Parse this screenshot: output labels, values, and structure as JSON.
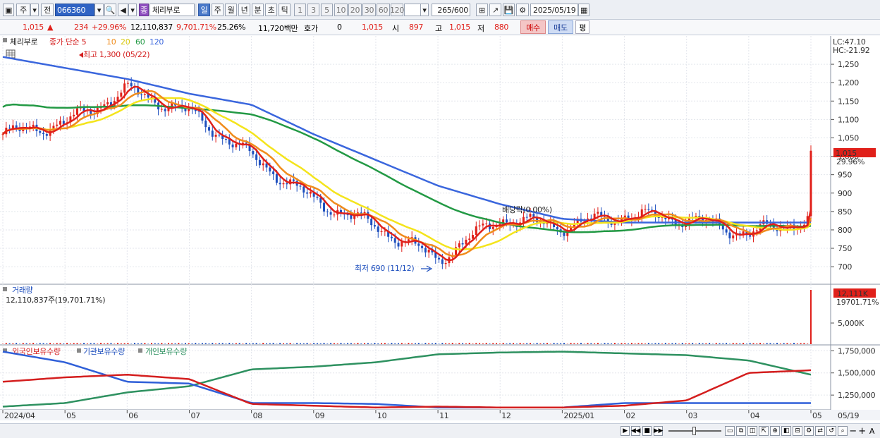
{
  "toolbar": {
    "market": "주",
    "prev_label": "전",
    "stock_code": "066360",
    "stock_name_badge": "종",
    "stock_name": "체리부로",
    "periods": [
      "일",
      "주",
      "월",
      "년",
      "분",
      "초",
      "틱"
    ],
    "selected_period": "일",
    "intervals": [
      "1",
      "3",
      "5",
      "10",
      "20",
      "30",
      "60",
      "120"
    ],
    "count": "265",
    "count_total": "/600",
    "date": "2025/05/19"
  },
  "info": {
    "price": "1,015",
    "change": "234",
    "change_pct": "+29.96%",
    "volume": "12,110,837",
    "volume_pct": "9,701.71%",
    "turnover": "25.26%",
    "amount": "11,720백만",
    "hoga_label": "호가",
    "hoga_value": "0",
    "hoga_price": "1,015",
    "open_label": "시",
    "open_value": "897",
    "high_label": "고",
    "high_value": "1,015",
    "low_label": "저",
    "low_value": "880",
    "buy_label": "매수",
    "sell_label": "매도",
    "avg_label": "평"
  },
  "price_pane": {
    "legend_name": "체리부로",
    "legend_ma": "종가 단순 5",
    "ma_periods": [
      "10",
      "20",
      "60",
      "120"
    ],
    "ma_colors": {
      "ma5": "#e0201a",
      "ma10": "#f08c1c",
      "ma20": "#f4e41c",
      "ma60": "#229944",
      "ma120": "#3a66dd"
    },
    "high_note": "최고 1,300 (05/22)",
    "low_note": "최저 690 (11/12)",
    "dividend_note": "배당락(0.00%)",
    "lc_label": "LC:47.10",
    "hc_label": "HC:-21.92",
    "current_label": "1,015",
    "current_pct": "29.96%"
  },
  "volume_pane": {
    "title": "거래량",
    "value_text": "12,110,837주(19,701.71%)",
    "current_label": "12,111K",
    "current_pct": "19701.71%",
    "axis_label": "5,000K"
  },
  "holdings_pane": {
    "foreign_label": "외국인보유수량",
    "inst_label": "기관보유수량",
    "indiv_label": "개인보유수량",
    "axis": [
      "1,750,000",
      "1,500,000",
      "1,250,000"
    ],
    "colors": {
      "foreign": "#d41e1e",
      "inst": "#2f5fd8",
      "indiv": "#2e9160"
    }
  },
  "x_axis": {
    "labels": [
      "2024/04",
      "05",
      "06",
      "07",
      "08",
      "09",
      "10",
      "11",
      "12",
      "2025/01",
      "02",
      "03",
      "04",
      "05"
    ],
    "end_label": "05/19"
  },
  "chart_data": [
    {
      "type": "line",
      "title": "체리부로",
      "x": [
        "2024/04",
        "2024/05",
        "2024/06",
        "2024/07",
        "2024/08",
        "2024/09",
        "2024/10",
        "2024/11",
        "2024/12",
        "2025/01",
        "2025/02",
        "2025/03",
        "2025/04",
        "2025/05"
      ],
      "ylim": [
        660,
        1300
      ],
      "y_ticks": [
        700,
        750,
        800,
        850,
        900,
        950,
        1000,
        1050,
        1100,
        1150,
        1200,
        1250
      ],
      "series": [
        {
          "name": "5",
          "values": [
            1060,
            1090,
            1180,
            1120,
            1000,
            880,
            810,
            720,
            830,
            810,
            840,
            830,
            790,
            830
          ]
        },
        {
          "name": "120",
          "values": [
            1270,
            1240,
            1210,
            1170,
            1140,
            1060,
            990,
            920,
            870,
            830,
            820,
            820,
            820,
            820
          ]
        }
      ],
      "annotations": [
        {
          "text": "최고 1,300 (05/22)",
          "value": 1300
        },
        {
          "text": "최저 690 (11/12)",
          "value": 690
        },
        {
          "text": "배당락(0.00%)"
        }
      ],
      "last_price": 1015
    },
    {
      "type": "bar",
      "title": "거래량",
      "y_ticks": [
        5000000
      ],
      "last_value": 12110837
    },
    {
      "type": "line",
      "x": [
        "2024/04",
        "2024/05",
        "2024/06",
        "2024/07",
        "2024/08",
        "2024/09",
        "2024/10",
        "2024/11",
        "2024/12",
        "2025/01",
        "2025/02",
        "2025/03",
        "2025/04",
        "2025/05"
      ],
      "y_ticks": [
        1250000,
        1500000,
        1750000
      ],
      "ylim": [
        1100000,
        1800000
      ],
      "series": [
        {
          "name": "외국인보유수량",
          "values": [
            1400000,
            1450000,
            1480000,
            1430000,
            1150000,
            1130000,
            1110000,
            1120000,
            1110000,
            1110000,
            1130000,
            1190000,
            1500000,
            1530000
          ]
        },
        {
          "name": "기관보유수량",
          "values": [
            1740000,
            1620000,
            1400000,
            1380000,
            1160000,
            1160000,
            1150000,
            1110000,
            1110000,
            1110000,
            1160000,
            1160000,
            1160000,
            1160000
          ]
        },
        {
          "name": "개인보유수량",
          "values": [
            1120000,
            1160000,
            1280000,
            1350000,
            1540000,
            1570000,
            1620000,
            1710000,
            1730000,
            1740000,
            1720000,
            1700000,
            1640000,
            1480000
          ]
        }
      ]
    }
  ]
}
